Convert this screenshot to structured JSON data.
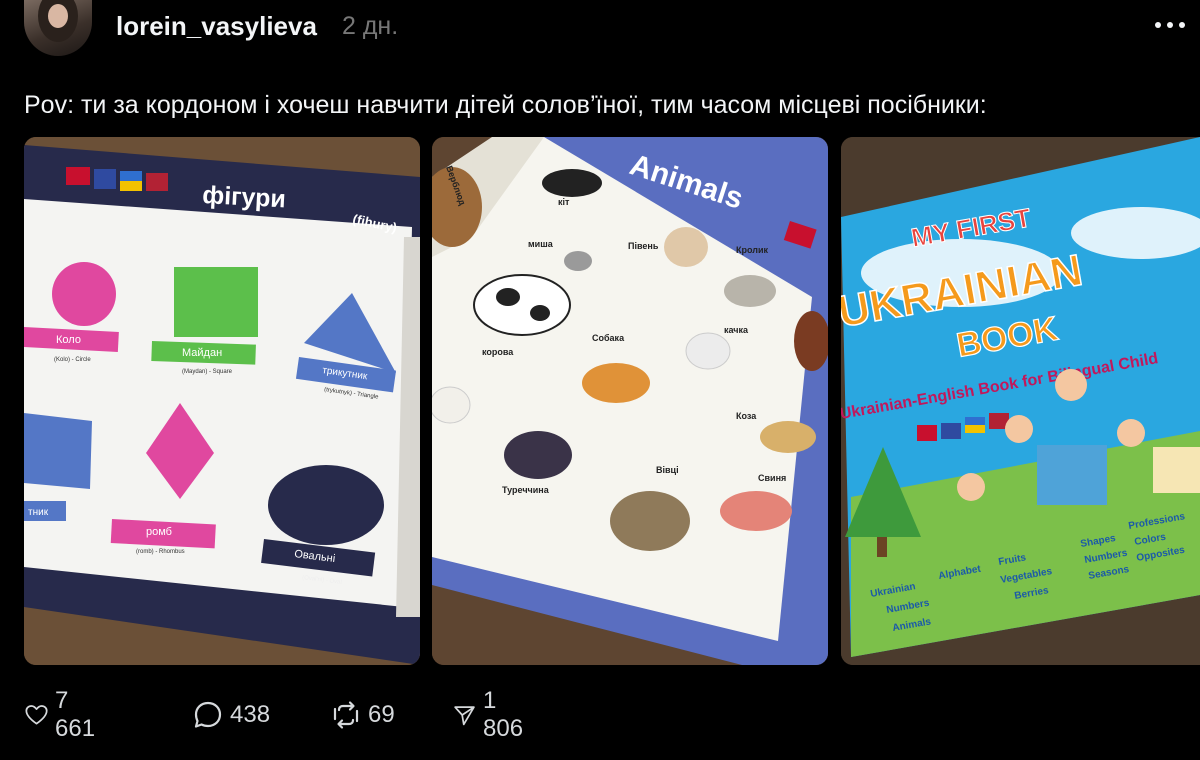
{
  "post": {
    "username": "lorein_vasylieva",
    "time": "2 дн.",
    "text": "Pov: ти за кордоном і хочеш навчити дітей солов’їної, тим часом місцеві посібники:"
  },
  "images": {
    "shapes": {
      "title": "фігури",
      "title_translit": "(fihury)",
      "labels": {
        "circle": "Коло",
        "circle_sub": "(Kolo) - Circle",
        "square": "Майдан",
        "square_sub": "(Maydan) - Square",
        "triangle": "трикутник",
        "triangle_sub": "(trykutnyk) - Triangle",
        "rhombus": "ромб",
        "rhombus_sub": "(romb) - Rhombus",
        "oval": "Овальні",
        "oval_sub": "(Oval'ni) - Oval",
        "rectangle": "тник"
      }
    },
    "animals": {
      "title": "Animals",
      "labels": {
        "cat": "кіт",
        "mouse": "миша",
        "rooster": "Півень",
        "rabbit": "Кролик",
        "cow": "корова",
        "dog": "Собака",
        "duck": "качка",
        "goat": "Коза",
        "turkey": "Туреччина",
        "sheep": "Вівці",
        "pig": "Свиня",
        "camel": "Верблюд"
      }
    },
    "book": {
      "line1": "MY FIRST",
      "line2": "UKRAINIAN",
      "line3": "BOOK",
      "subtitle": "Ukrainian-English Book for Bilingual Child",
      "topics": [
        "Ukrainian",
        "Alphabet",
        "Numbers",
        "Animals",
        "Fruits",
        "Vegetables",
        "Berries",
        "Shapes",
        "Numbers",
        "Seasons",
        "Professions",
        "Colors",
        "Opposites"
      ]
    }
  },
  "actions": {
    "likes": "7 661",
    "comments": "438",
    "reposts": "69",
    "shares": "1 806"
  },
  "colors": {
    "background": "#000000",
    "text": "#f3f5f7",
    "muted": "#777777",
    "book_blue": "#2aa7e0",
    "book_orange": "#f59a1c",
    "shape_pink": "#e0489f",
    "shape_green": "#5cbf4b",
    "shape_blue": "#5477c6",
    "page_navy": "#272a4b"
  },
  "icons": [
    "more-icon",
    "heart-icon",
    "comment-icon",
    "repost-icon",
    "share-icon"
  ]
}
